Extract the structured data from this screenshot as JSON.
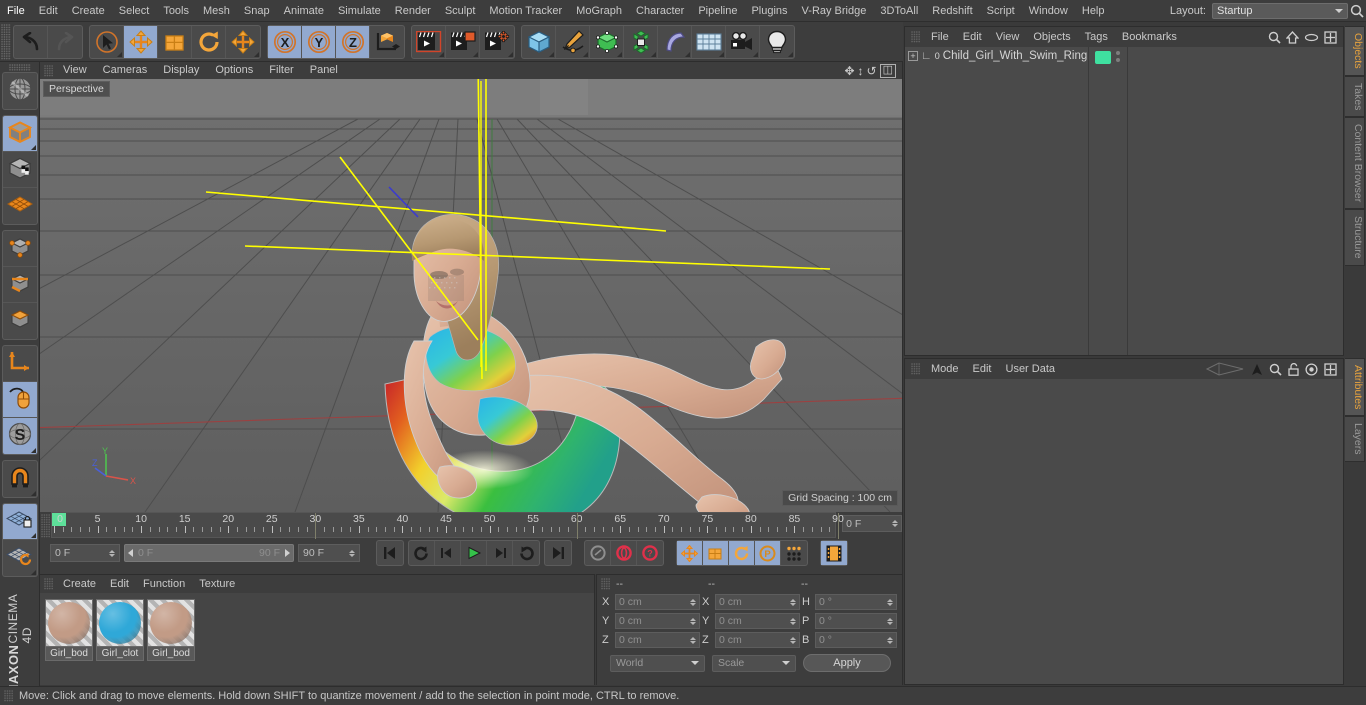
{
  "app": {
    "name": "CINEMA 4D",
    "vendor": "MAXON"
  },
  "menubar": {
    "items": [
      "File",
      "Edit",
      "Create",
      "Select",
      "Tools",
      "Mesh",
      "Snap",
      "Animate",
      "Simulate",
      "Render",
      "Sculpt",
      "Motion Tracker",
      "MoGraph",
      "Character",
      "Pipeline",
      "Plugins",
      "V-Ray Bridge",
      "3DToAll",
      "Redshift",
      "Script",
      "Window",
      "Help"
    ],
    "layout_label": "Layout:",
    "layout_value": "Startup",
    "right_icons": [
      "search-icon"
    ]
  },
  "toolbar": {
    "groups": [
      {
        "name": "undo-redo",
        "buttons": [
          {
            "name": "undo",
            "icon": "undo-arrow",
            "active": false,
            "corner": false
          },
          {
            "name": "redo",
            "icon": "redo-arrow",
            "active": false,
            "corner": false
          }
        ]
      },
      {
        "name": "transform-tools",
        "buttons": [
          {
            "name": "live-selection",
            "icon": "cursor-circle",
            "active": false,
            "corner": true
          },
          {
            "name": "move",
            "icon": "move-arrows",
            "active": true,
            "corner": false
          },
          {
            "name": "scale",
            "icon": "scale-box",
            "active": false,
            "corner": false
          },
          {
            "name": "rotate",
            "icon": "rotate-circle",
            "active": false,
            "corner": false
          },
          {
            "name": "move-dup",
            "icon": "move-arrows",
            "active": false,
            "corner": true
          }
        ]
      },
      {
        "name": "axis-locks",
        "buttons": [
          {
            "name": "lock-x",
            "icon": "x-axis",
            "active": true,
            "corner": false
          },
          {
            "name": "lock-y",
            "icon": "y-axis",
            "active": true,
            "corner": false
          },
          {
            "name": "lock-z",
            "icon": "z-axis",
            "active": true,
            "corner": false
          },
          {
            "name": "world-object-coord",
            "icon": "coord-cube",
            "active": false,
            "corner": false
          }
        ]
      },
      {
        "name": "render-tools",
        "buttons": [
          {
            "name": "render-view",
            "icon": "clapper",
            "active": false,
            "corner": true
          },
          {
            "name": "render-region",
            "icon": "clapper-region",
            "active": false,
            "corner": true
          },
          {
            "name": "render-settings",
            "icon": "clapper-gear",
            "active": false,
            "corner": true
          }
        ]
      },
      {
        "name": "create-objects",
        "buttons": [
          {
            "name": "add-cube",
            "icon": "cube-blue",
            "active": false,
            "corner": true
          },
          {
            "name": "add-spline",
            "icon": "pen-spline",
            "active": false,
            "corner": true
          },
          {
            "name": "add-generator",
            "icon": "green-cube",
            "active": false,
            "corner": true
          },
          {
            "name": "add-array",
            "icon": "green-cluster",
            "active": false,
            "corner": true
          },
          {
            "name": "add-deformer",
            "icon": "bend-deformer",
            "active": false,
            "corner": true
          },
          {
            "name": "add-environment",
            "icon": "floor-grid",
            "active": false,
            "corner": true
          },
          {
            "name": "add-camera",
            "icon": "camera",
            "active": false,
            "corner": true
          },
          {
            "name": "add-light",
            "icon": "light-bulb",
            "active": false,
            "corner": true
          }
        ]
      }
    ]
  },
  "left_palette": {
    "groups": [
      {
        "buttons": [
          {
            "name": "model-globe",
            "icon": "globe-wire",
            "active": false,
            "corner": false
          }
        ]
      },
      {
        "buttons": [
          {
            "name": "model-mode",
            "icon": "cube-orange-outline",
            "active": true,
            "corner": true
          },
          {
            "name": "texture-mode",
            "icon": "cube-checker",
            "active": false,
            "corner": false
          },
          {
            "name": "polygon-grid-mode",
            "icon": "orange-lattice",
            "active": false,
            "corner": false
          }
        ]
      },
      {
        "buttons": [
          {
            "name": "points-mode",
            "icon": "cube-points",
            "active": false,
            "corner": false
          },
          {
            "name": "edges-mode",
            "icon": "cube-edges",
            "active": false,
            "corner": false
          },
          {
            "name": "polygons-mode",
            "icon": "cube-polys",
            "active": false,
            "corner": false
          }
        ]
      },
      {
        "buttons": [
          {
            "name": "axis-mode",
            "icon": "axis-l",
            "active": false,
            "corner": false
          },
          {
            "name": "enable-tweak",
            "icon": "mouse-tweak",
            "active": true,
            "corner": false
          },
          {
            "name": "soft-selection",
            "icon": "s-sphere",
            "active": true,
            "corner": true
          }
        ]
      },
      {
        "buttons": [
          {
            "name": "snap-magnet",
            "icon": "magnet",
            "active": false,
            "corner": true
          }
        ]
      },
      {
        "buttons": [
          {
            "name": "lock-workplane",
            "icon": "grid-lock",
            "active": true,
            "corner": true
          },
          {
            "name": "workplane-rotate",
            "icon": "grid-rotate",
            "active": false,
            "corner": true
          }
        ]
      }
    ]
  },
  "viewport": {
    "menu": [
      "View",
      "Cameras",
      "Display",
      "Options",
      "Filter",
      "Panel"
    ],
    "right_icons": [
      "pan-icon",
      "move-up-down-icon",
      "rotate-icon",
      "maximize-icon"
    ],
    "label": "Perspective",
    "grid_spacing": "Grid Spacing : 100 cm",
    "axis": {
      "x": "X",
      "y": "Y",
      "z": "Z",
      "x_color": "#d9544a",
      "y_color": "#4fc24f",
      "z_color": "#4a5fd9"
    },
    "scene_description": "3D child girl character sitting in a colorful swim ring, selection highlighted in yellow"
  },
  "timeline": {
    "ticks": [
      "0",
      "5",
      "10",
      "15",
      "20",
      "25",
      "30",
      "35",
      "40",
      "45",
      "50",
      "55",
      "60",
      "65",
      "70",
      "75",
      "80",
      "85",
      "90"
    ],
    "start_frame": "0 F",
    "range_start": "0 F",
    "range_end": "90 F",
    "end_frame": "90 F",
    "current_frame": "0 F",
    "buttons": [
      {
        "name": "go-to-start",
        "icon": "skip-start",
        "active": false
      },
      {
        "name": "play-backwards-loop",
        "icon": "loop-back",
        "active": false
      },
      {
        "name": "step-back",
        "icon": "step-back",
        "active": false
      },
      {
        "name": "play-forward",
        "icon": "play",
        "active": false
      },
      {
        "name": "step-forward",
        "icon": "step-forward",
        "active": false
      },
      {
        "name": "play-loop",
        "icon": "loop",
        "active": false
      },
      {
        "name": "go-to-end",
        "icon": "skip-end",
        "active": false
      }
    ],
    "record_buttons": [
      {
        "name": "autokey-toggle",
        "icon": "key-grey",
        "active": false
      },
      {
        "name": "record-active-objects",
        "icon": "record-red",
        "active": false
      },
      {
        "name": "keyframe-selection",
        "icon": "question-red",
        "active": false
      }
    ],
    "param_buttons": [
      {
        "name": "record-position",
        "icon": "move-arrows",
        "active": true
      },
      {
        "name": "record-scale",
        "icon": "scale-box",
        "active": true
      },
      {
        "name": "record-rotation",
        "icon": "rotate-circle",
        "active": true
      },
      {
        "name": "record-pla",
        "icon": "p-circle",
        "active": true
      },
      {
        "name": "record-points",
        "icon": "dot-matrix",
        "active": false
      },
      {
        "name": "timeline-toggle",
        "icon": "film-strip",
        "active": true
      }
    ]
  },
  "materials": {
    "menu": [
      "Create",
      "Edit",
      "Function",
      "Texture"
    ],
    "items": [
      {
        "name": "Girl_bod",
        "swatch": "#c29b86"
      },
      {
        "name": "Girl_clot",
        "swatch": "#2fa8d8"
      },
      {
        "name": "Girl_bod",
        "swatch": "#c29b86"
      }
    ]
  },
  "coordinates": {
    "headers": [
      "--",
      "--",
      "--"
    ],
    "rows": [
      {
        "label1": "X",
        "value1": "0 cm",
        "label2": "X",
        "value2": "0 cm",
        "label3": "H",
        "value3": "0 °"
      },
      {
        "label1": "Y",
        "value1": "0 cm",
        "label2": "Y",
        "value2": "0 cm",
        "label3": "P",
        "value3": "0 °"
      },
      {
        "label1": "Z",
        "value1": "0 cm",
        "label2": "Z",
        "value2": "0 cm",
        "label3": "B",
        "value3": "0 °"
      }
    ],
    "coord_system": "World",
    "mode": "Scale",
    "apply_label": "Apply"
  },
  "object_manager": {
    "menu": [
      "File",
      "Edit",
      "View",
      "Objects",
      "Tags",
      "Bookmarks"
    ],
    "right_icons": [
      "search-icon",
      "home-icon",
      "eye-icon",
      "layout-icon"
    ],
    "object": {
      "name": "Child_Girl_With_Swim_Ring",
      "layer_badge": "0",
      "tag_color": "#3fe0a0"
    }
  },
  "attributes_manager": {
    "menu": [
      "Mode",
      "Edit",
      "User Data"
    ],
    "right_icons": [
      "arrow-up-icon",
      "search-icon",
      "lock-icon",
      "target-icon",
      "layout-icon"
    ]
  },
  "right_tabs": {
    "upper": [
      {
        "label": "Objects",
        "active": true
      },
      {
        "label": "Takes",
        "active": false
      },
      {
        "label": "Content Browser",
        "active": false
      },
      {
        "label": "Structure",
        "active": false
      }
    ],
    "lower": [
      {
        "label": "Attributes",
        "active": true
      },
      {
        "label": "Layers",
        "active": false
      }
    ]
  },
  "statusbar": {
    "text": "Move: Click and drag to move elements. Hold down SHIFT to quantize movement / add to the selection in point mode, CTRL to remove."
  },
  "colors": {
    "panel_bg": "#3d3d3d",
    "panel_dark": "#2d2d2d",
    "field_bg": "#4f4f4f",
    "active_blue": "#92a9cf",
    "accent_orange": "#e8a33d",
    "selection_yellow": "#ffff00",
    "text": "#c8c8c8"
  }
}
